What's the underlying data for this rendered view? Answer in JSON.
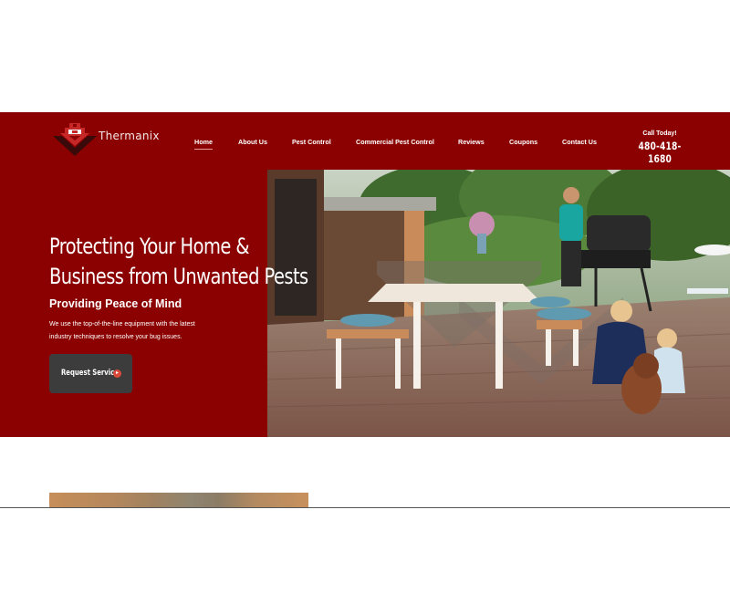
{
  "brand": {
    "name": "Thermanix"
  },
  "nav": {
    "items": [
      {
        "label": "Home",
        "active": true
      },
      {
        "label": "About Us"
      },
      {
        "label": "Pest Control"
      },
      {
        "label": "Commercial Pest Control"
      },
      {
        "label": "Reviews"
      },
      {
        "label": "Coupons"
      },
      {
        "label": "Contact Us"
      }
    ]
  },
  "call": {
    "label": "Call Today!",
    "phone": "480-418-1680"
  },
  "hero": {
    "title_line1": "Protecting Your Home &",
    "title_line2": "Business from Unwanted Pests",
    "subtitle": "Providing Peace of Mind",
    "desc_line1": "We use the top-of-the-line equipment with the latest",
    "desc_line2": "industry techniques to resolve your bug issues.",
    "cta_label": "Request Service",
    "cta_icon": "arrow-right-circle-icon"
  },
  "colors": {
    "brand_red": "#8b0000",
    "button_dark": "#3c3c3c",
    "accent_red": "#d94a3a"
  }
}
